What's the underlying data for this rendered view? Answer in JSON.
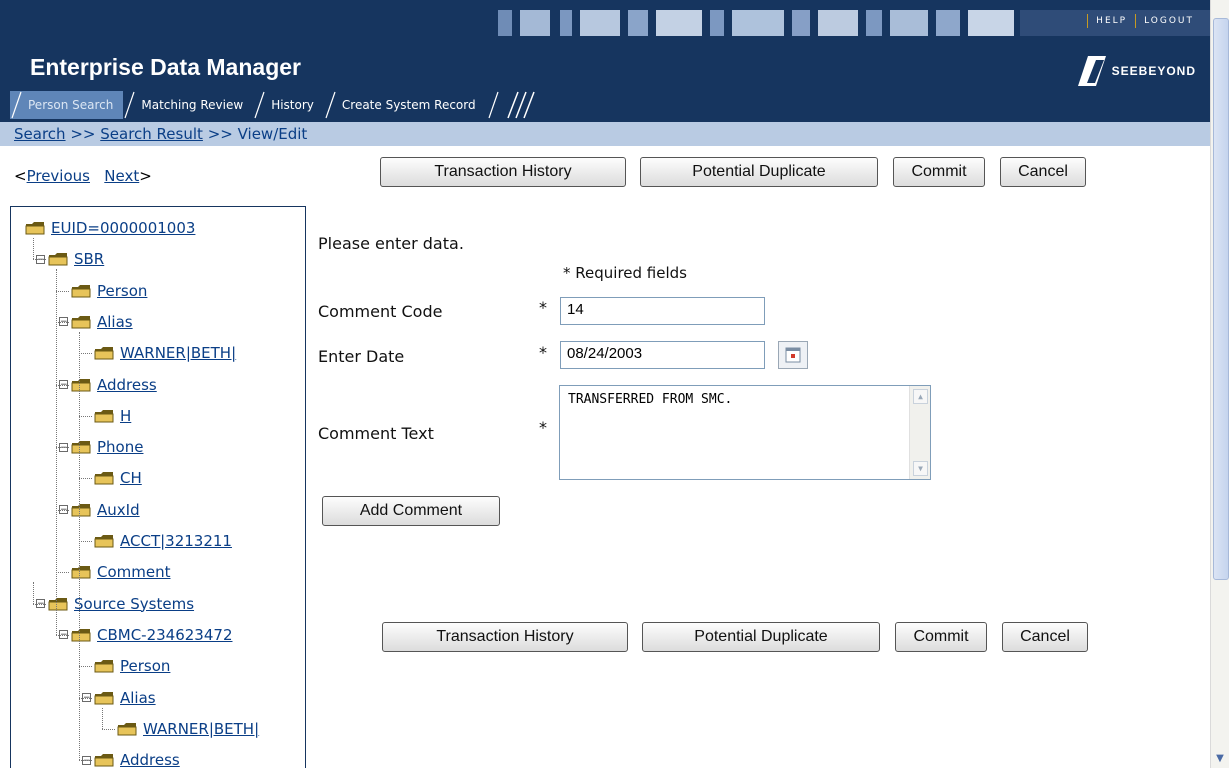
{
  "header": {
    "title": "Enterprise Data Manager",
    "logo_text": "SeeBeyond",
    "links": {
      "help": "HELP",
      "logout": "LOGOUT"
    },
    "tabs": [
      "Person Search",
      "Matching Review",
      "History",
      "Create System Record"
    ],
    "active_tab": "Person Search"
  },
  "breadcrumb": {
    "search": "Search",
    "sep": ">>",
    "result": "Search Result",
    "current": "View/Edit"
  },
  "nav": {
    "prev_mark": "<",
    "prev": "Previous",
    "next": "Next",
    "next_mark": ">"
  },
  "buttons": {
    "transaction_history": "Transaction History",
    "potential_duplicate": "Potential Duplicate",
    "commit": "Commit",
    "cancel": "Cancel",
    "add_comment": "Add Comment"
  },
  "tree": [
    {
      "label": "EUID=0000001003",
      "level": 0,
      "expander": ""
    },
    {
      "label": "SBR",
      "level": 1,
      "expander": "−"
    },
    {
      "label": "Person",
      "level": 2,
      "expander": ""
    },
    {
      "label": "Alias",
      "level": 2,
      "expander": "−"
    },
    {
      "label": "WARNER|BETH|",
      "level": 3,
      "expander": ""
    },
    {
      "label": "Address",
      "level": 2,
      "expander": "−"
    },
    {
      "label": "H",
      "level": 3,
      "expander": ""
    },
    {
      "label": "Phone",
      "level": 2,
      "expander": "−"
    },
    {
      "label": "CH",
      "level": 3,
      "expander": ""
    },
    {
      "label": "AuxId",
      "level": 2,
      "expander": "−"
    },
    {
      "label": "ACCT|3213211",
      "level": 3,
      "expander": ""
    },
    {
      "label": "Comment",
      "level": 2,
      "expander": ""
    },
    {
      "label": "Source Systems",
      "level": 1,
      "expander": "−"
    },
    {
      "label": "CBMC-234623472",
      "level": 2,
      "expander": "−"
    },
    {
      "label": "Person",
      "level": 3,
      "expander": ""
    },
    {
      "label": "Alias",
      "level": 3,
      "expander": "−"
    },
    {
      "label": "WARNER|BETH|",
      "level": 4,
      "expander": ""
    },
    {
      "label": "Address",
      "level": 3,
      "expander": "−"
    }
  ],
  "form": {
    "intro": "Please enter data.",
    "required_note": "* Required fields",
    "required_mark": "*",
    "comment_code_label": "Comment Code",
    "comment_code_value": "14",
    "enter_date_label": "Enter Date",
    "enter_date_value": "08/24/2003",
    "comment_text_label": "Comment Text",
    "comment_text_value": "TRANSFERRED FROM SMC."
  },
  "colors": {
    "header": "#16355f",
    "tab_active": "#5f86b8",
    "crumb_bar": "#b9cbe3",
    "link": "#0a3e86",
    "accent": "#c79a22"
  }
}
